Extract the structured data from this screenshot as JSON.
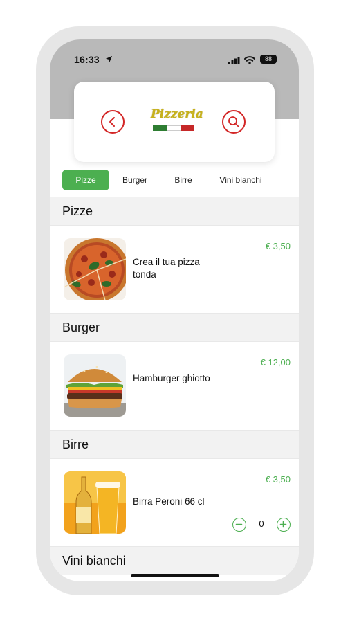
{
  "status_bar": {
    "time": "16:33",
    "battery": "88"
  },
  "header": {
    "logo_text": "Pizzeria"
  },
  "tabs": [
    {
      "label": "Pizze"
    },
    {
      "label": "Burger"
    },
    {
      "label": "Birre"
    },
    {
      "label": "Vini bianchi"
    }
  ],
  "sections": [
    {
      "title": "Pizze",
      "items": [
        {
          "name": "Crea il tua pizza tonda",
          "price": "€ 3,50"
        }
      ]
    },
    {
      "title": "Burger",
      "items": [
        {
          "name": "Hamburger ghiotto",
          "price": "€ 12,00"
        }
      ]
    },
    {
      "title": "Birre",
      "items": [
        {
          "name": "Birra Peroni 66 cl",
          "price": "€ 3,50",
          "quantity": "0"
        }
      ]
    },
    {
      "title": "Vini bianchi",
      "items": []
    }
  ],
  "colors": {
    "accent": "#4caf50",
    "brand_red": "#d32626",
    "header_gray": "#b9b9b9"
  },
  "icons": {
    "back": "chevron-left-icon",
    "search": "search-icon",
    "location": "location-arrow-icon",
    "signal": "signal-icon",
    "wifi": "wifi-icon",
    "battery": "battery-icon",
    "minus": "minus-icon",
    "plus": "plus-icon"
  }
}
